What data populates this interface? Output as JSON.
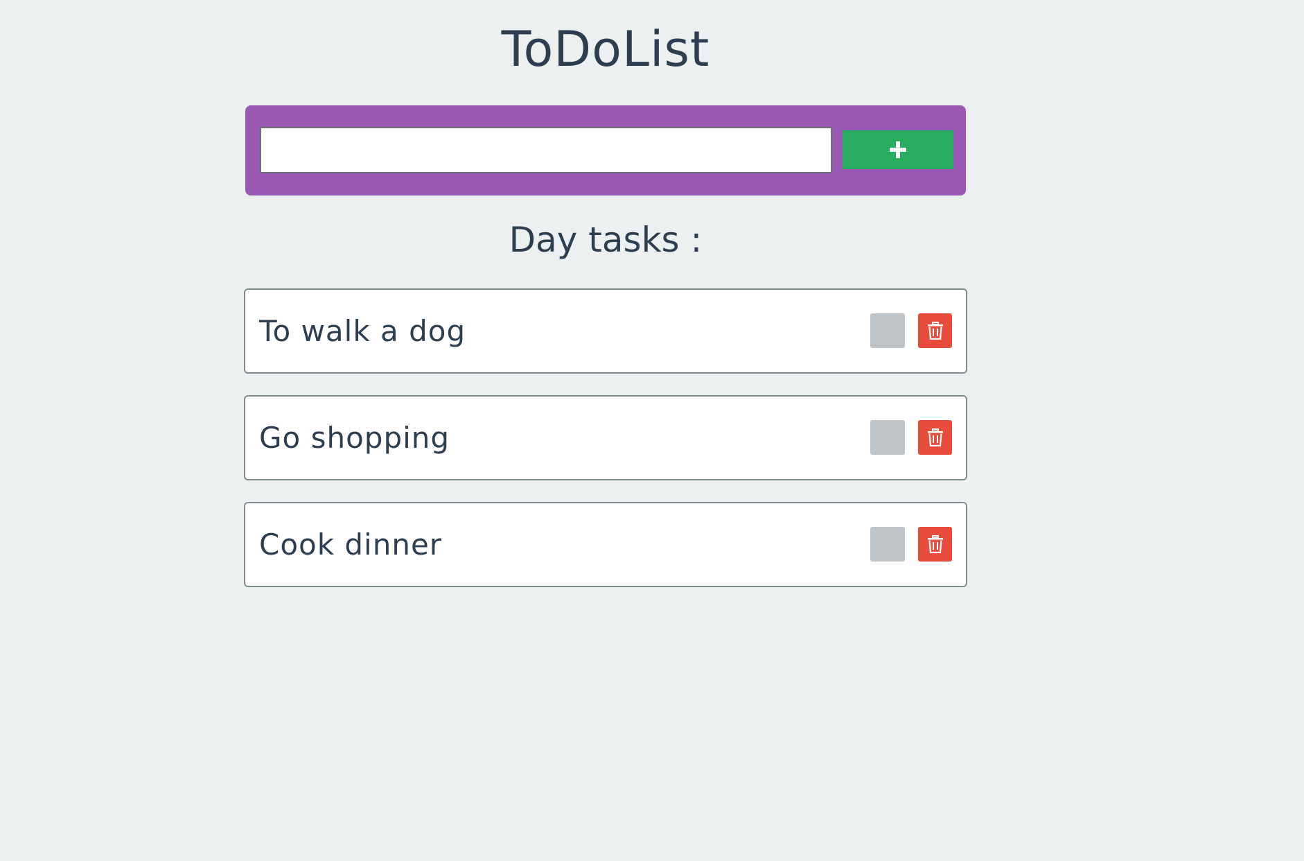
{
  "app": {
    "title": "ToDoList"
  },
  "add_form": {
    "input_value": "",
    "input_placeholder": "",
    "add_icon": "plus-icon"
  },
  "section": {
    "heading": "Day tasks :"
  },
  "tasks": [
    {
      "text": "To walk a dog",
      "completed": false
    },
    {
      "text": "Go shopping",
      "completed": false
    },
    {
      "text": "Cook dinner",
      "completed": false
    }
  ],
  "icons": {
    "complete": "checkbox-icon",
    "delete": "trash-icon"
  },
  "colors": {
    "background": "#ecf0f1",
    "text": "#2c3e50",
    "add_bar": "#9b59b6",
    "add_button": "#27ae60",
    "checkbox": "#bdc3c7",
    "delete_button": "#e74c3c"
  }
}
